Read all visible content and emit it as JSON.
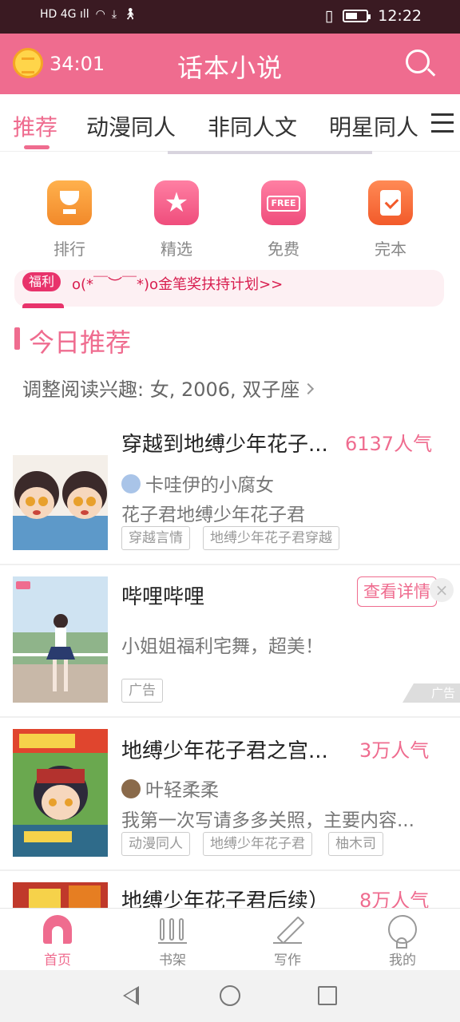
{
  "status_bar": {
    "left_indicators": "HD 4G ıll",
    "time": "12:22"
  },
  "header": {
    "timer": "34:01",
    "title": "话本小说"
  },
  "tabs": [
    {
      "label": "推荐",
      "active": true
    },
    {
      "label": "动漫同人",
      "active": false
    },
    {
      "label": "非同人文",
      "active": false
    },
    {
      "label": "明星同人",
      "active": false
    }
  ],
  "quick_entries": [
    {
      "label": "排行",
      "icon": "trophy-icon"
    },
    {
      "label": "精选",
      "icon": "star-icon"
    },
    {
      "label": "免费",
      "icon": "free-badge-icon",
      "badge": "FREE"
    },
    {
      "label": "完本",
      "icon": "checked-book-icon"
    }
  ],
  "notice": {
    "tag": "福利",
    "text": "o(*￣︶￣*)o金笔奖扶持计划>>"
  },
  "section": {
    "title": "今日推荐",
    "interest": "调整阅读兴趣: 女, 2006, 双子座"
  },
  "cards": [
    {
      "title": "穿越到地缚少年花子...",
      "popularity": "6137人气",
      "author": "卡哇伊的小腐女",
      "desc": "花子君地缚少年花子君",
      "tags": [
        "穿越言情",
        "地缚少年花子君穿越"
      ]
    },
    {
      "title": "哔哩哔哩",
      "desc": "小姐姐福利宅舞，超美！",
      "ad_button": "查看详情",
      "ad_tag": "广告",
      "ad_mark": "广告",
      "close": "×"
    },
    {
      "title": "地缚少年花子君之宫...",
      "popularity": "3万人气",
      "author": "叶轻柔柔",
      "desc": "我第一次写请多多关照，主要内容...",
      "tags": [
        "动漫同人",
        "地缚少年花子君",
        "柚木司"
      ]
    },
    {
      "title": "地缚少年花子君后续）",
      "popularity": "8万人气"
    }
  ],
  "bottom_nav": [
    {
      "label": "首页",
      "active": true
    },
    {
      "label": "书架",
      "active": false
    },
    {
      "label": "写作",
      "active": false
    },
    {
      "label": "我的",
      "active": false
    }
  ],
  "colors": {
    "accent": "#ef6c8f",
    "status_bar": "#3a1a22",
    "notice_text": "#d81e4f"
  }
}
